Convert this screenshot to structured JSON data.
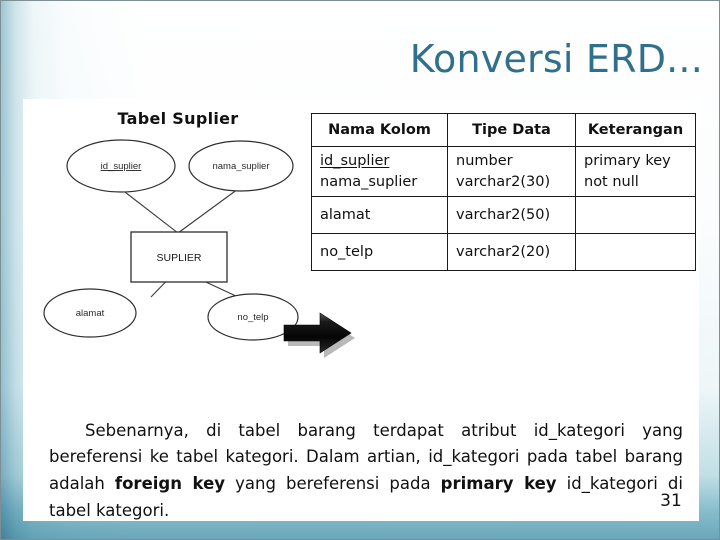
{
  "slide": {
    "title": "Konversi ERD...",
    "page_number": "31",
    "accent_color": "#31708a",
    "band_color": "#7cb8c8"
  },
  "erd": {
    "heading": "Tabel Suplier",
    "entity": "SUPLIER",
    "attributes": [
      {
        "label": "id_suplier",
        "primary_key": true
      },
      {
        "label": "nama_suplier",
        "primary_key": false
      },
      {
        "label": "alamat",
        "primary_key": false
      },
      {
        "label": "no_telp",
        "primary_key": false
      }
    ],
    "arrow_icon": "right-arrow-icon"
  },
  "table": {
    "headers": [
      "Nama Kolom",
      "Tipe Data",
      "Keterangan"
    ],
    "rows": [
      {
        "names": [
          "id_suplier",
          "nama_suplier"
        ],
        "types": [
          "number",
          "varchar2(30)"
        ],
        "notes": [
          "primary key",
          "not null"
        ]
      },
      {
        "names": [
          "alamat"
        ],
        "types": [
          "varchar2(50)"
        ],
        "notes": [
          ""
        ]
      },
      {
        "names": [
          "no_telp"
        ],
        "types": [
          "varchar2(20)"
        ],
        "notes": [
          ""
        ]
      }
    ],
    "cells": {
      "r0_name_0": "id_suplier",
      "r0_name_1": "nama_suplier",
      "r0_type_0": "number",
      "r0_type_1": "varchar2(30)",
      "r0_note_0": "primary key",
      "r0_note_1": "not null",
      "r1_name": "alamat",
      "r1_type": "varchar2(50)",
      "r1_note": "",
      "r2_name": "no_telp",
      "r2_type": "varchar2(20)",
      "r2_note": ""
    }
  },
  "paragraph": {
    "part1": "Sebenarnya, di tabel barang terdapat atribut id_kategori yang bereferensi ke tabel kategori. Dalam artian, id_kategori pada tabel barang adalah ",
    "bold1": "foreign key",
    "part2": " yang bereferensi pada ",
    "bold2": "primary key",
    "part3": " id_kategori di tabel kategori."
  }
}
